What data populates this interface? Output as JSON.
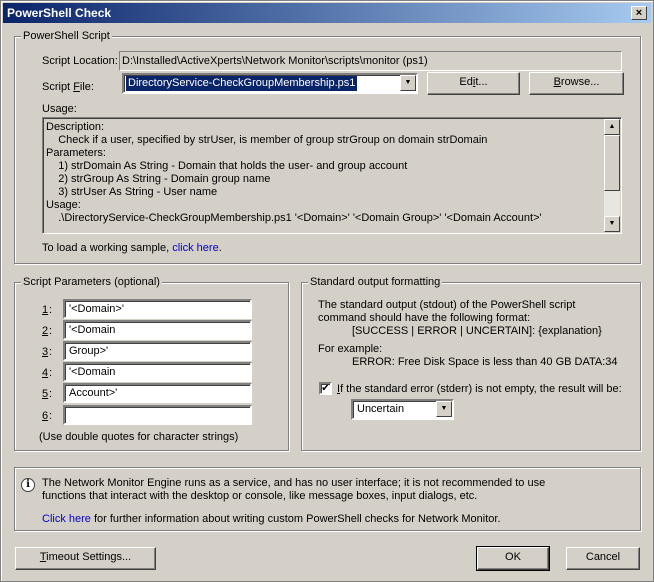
{
  "window": {
    "title": "PowerShell Check",
    "close_glyph": "×"
  },
  "script_group": {
    "title": "PowerShell Script",
    "location_label": "Script Location:",
    "location_value": "D:\\Installed\\ActiveXperts\\Network Monitor\\scripts\\monitor (ps1)",
    "file_label_pre": "Script ",
    "file_label_u": "F",
    "file_label_post": "ile:",
    "file_value": "DirectoryService-CheckGroupMembership.ps1",
    "edit_pre": "Ed",
    "edit_u": "i",
    "edit_post": "t...",
    "browse_u": "B",
    "browse_post": "rowse...",
    "usage_label": "Usage:",
    "usage_lines": [
      "Description:",
      "    Check if a user, specified by strUser, is member of group strGroup on domain strDomain",
      "Parameters:",
      "    1) strDomain As String - Domain that holds the user- and group account",
      "    2) strGroup As String - Domain group name",
      "    3) strUser As String - User name",
      "Usage:",
      "    .\\DirectoryService-CheckGroupMembership.ps1 '<Domain>' '<Domain Group>' '<Domain Account>'"
    ],
    "sample_text": "To load a working sample, ",
    "sample_link": "click here",
    "sample_suffix": "."
  },
  "params_group": {
    "title": "Script Parameters (optional)",
    "params": [
      {
        "label": "1",
        "value": "'<Domain>'"
      },
      {
        "label": "2",
        "value": "'<Domain"
      },
      {
        "label": "3",
        "value": "Group>'"
      },
      {
        "label": "4",
        "value": "'<Domain"
      },
      {
        "label": "5",
        "value": "Account>'"
      },
      {
        "label": "6",
        "value": ""
      }
    ],
    "colon": ":",
    "note": "(Use double quotes for character strings)"
  },
  "output_group": {
    "title": "Standard output formatting",
    "line1": "The standard output (stdout) of the PowerShell script",
    "line2": "command should have the following format:",
    "format": "[SUCCESS | ERROR | UNCERTAIN]: {explanation}",
    "example_label": "For example:",
    "example": "ERROR: Free Disk Space is less than 40 GB DATA:34",
    "stderr_u": "I",
    "stderr_post": "f the standard error (stderr) is not empty, the result will be:",
    "stderr_checked": true,
    "check_glyph": "✔",
    "result_value": "Uncertain"
  },
  "info": {
    "icon": "info-icon",
    "line1": "The Network Monitor Engine runs as a service, and has no user interface; it is not recommended to use",
    "line2": "functions that interact with the desktop or console, like message boxes, input dialogs, etc.",
    "link": "Click here",
    "line3": " for further information about writing custom PowerShell checks for Network Monitor."
  },
  "footer": {
    "timeout_u": "T",
    "timeout_post": "imeout Settings...",
    "ok_label": "OK",
    "cancel_label": "Cancel"
  },
  "colors": {
    "face": "#d4d0c8",
    "title_start": "#0a246a",
    "title_end": "#a6caf0",
    "link": "#0000cc"
  }
}
